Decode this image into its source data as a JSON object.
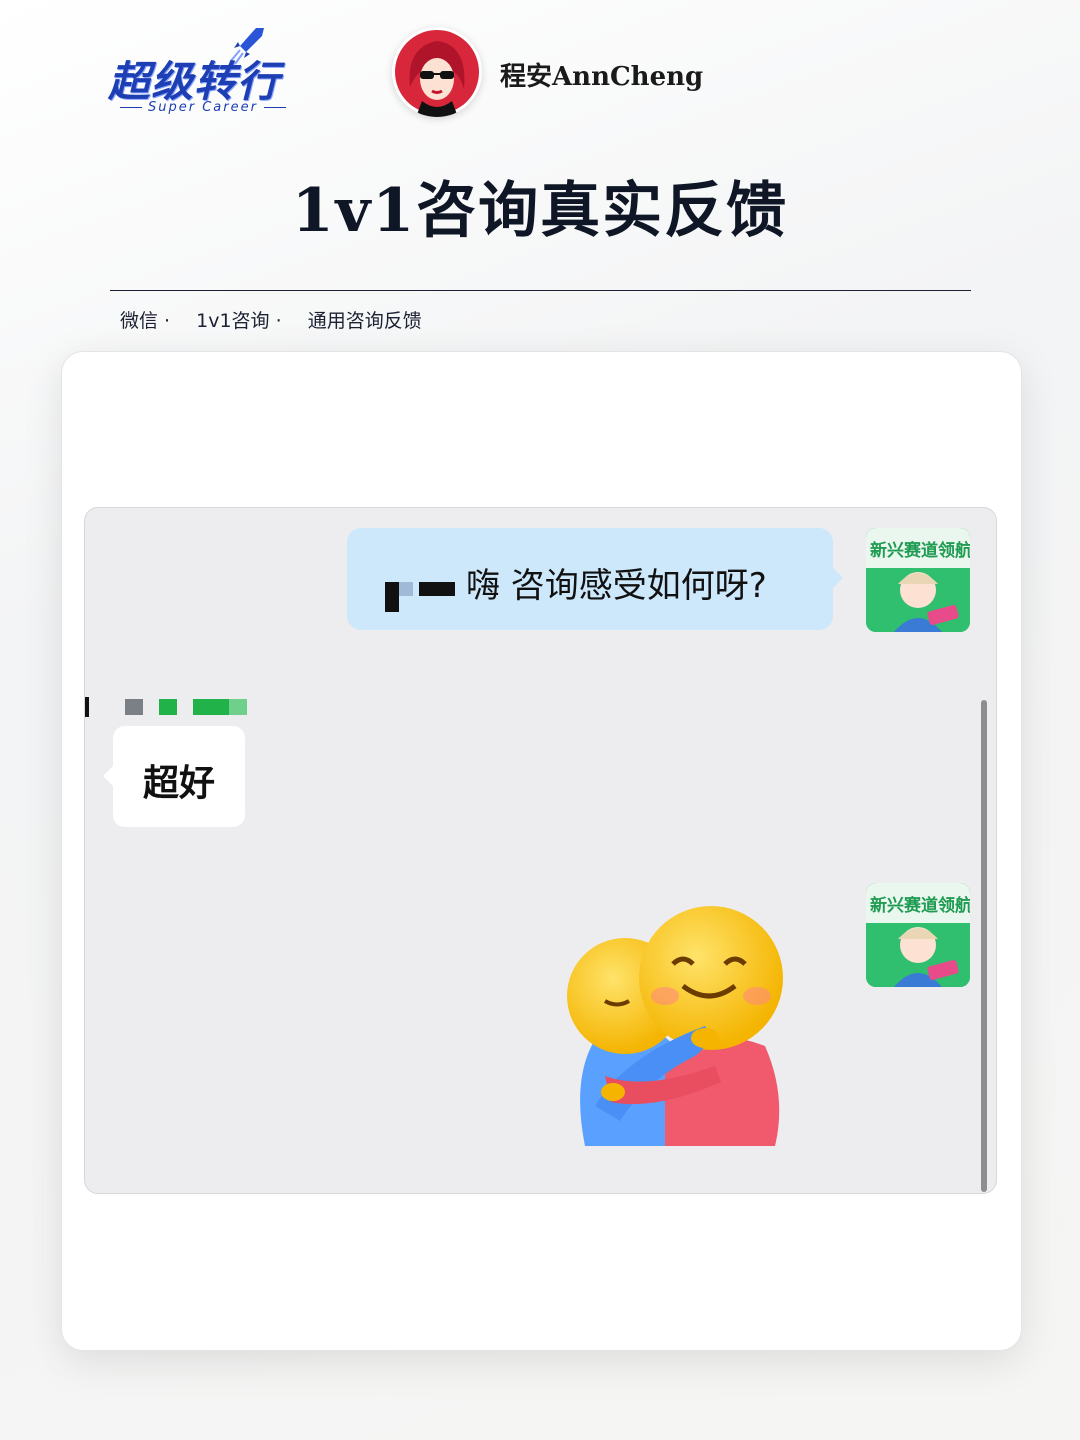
{
  "brand": {
    "title": "超级转行",
    "subtitle": "Super Career",
    "color": "#1d3fb3"
  },
  "author": {
    "name": "程安AnnCheng",
    "avatar_icon": "avatar-woman-sunglasses-icon"
  },
  "page_title": "1v1咨询真实反馈",
  "breadcrumb": [
    "微信 ·",
    "1v1咨询 ·",
    "通用咨询反馈"
  ],
  "chat": {
    "messages": [
      {
        "side": "right",
        "type": "text",
        "text": "嗨 咨询感受如何呀?",
        "bubble_color": "#cde7fb"
      },
      {
        "side": "left",
        "type": "text",
        "text": "超好",
        "bubble_color": "#ffffff"
      },
      {
        "side": "right",
        "type": "sticker",
        "icon": "hug-emoji-sticker-icon"
      }
    ],
    "background": "#ededf0"
  }
}
